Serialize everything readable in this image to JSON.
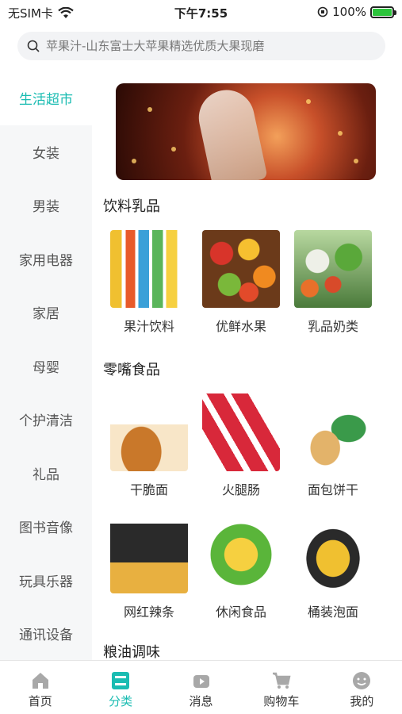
{
  "status_bar": {
    "carrier": "无SIM卡",
    "time": "下午7:55",
    "battery": "100%",
    "battery_level": 1.0
  },
  "search": {
    "placeholder": "苹果汁-山东富士大苹果精选优质大果现磨"
  },
  "sidebar": {
    "items": [
      {
        "label": "生活超市",
        "active": true
      },
      {
        "label": "女装"
      },
      {
        "label": "男装"
      },
      {
        "label": "家用电器"
      },
      {
        "label": "家居"
      },
      {
        "label": "母婴"
      },
      {
        "label": "个护清洁"
      },
      {
        "label": "礼品"
      },
      {
        "label": "图书音像"
      },
      {
        "label": "玩具乐器"
      },
      {
        "label": "通讯设备"
      }
    ]
  },
  "sections": [
    {
      "title": "饮料乳品",
      "items": [
        {
          "label": "果汁饮料"
        },
        {
          "label": "优鲜水果"
        },
        {
          "label": "乳品奶类"
        }
      ]
    },
    {
      "title": "零嘴食品",
      "items": [
        {
          "label": "干脆面"
        },
        {
          "label": "火腿肠"
        },
        {
          "label": "面包饼干"
        },
        {
          "label": "网红辣条"
        },
        {
          "label": "休闲食品"
        },
        {
          "label": "桶装泡面"
        }
      ]
    },
    {
      "title": "粮油调味"
    }
  ],
  "tabbar": {
    "items": [
      {
        "label": "首页"
      },
      {
        "label": "分类",
        "active": true
      },
      {
        "label": "消息"
      },
      {
        "label": "购物车"
      },
      {
        "label": "我的"
      }
    ]
  },
  "colors": {
    "accent": "#1abcb2"
  }
}
